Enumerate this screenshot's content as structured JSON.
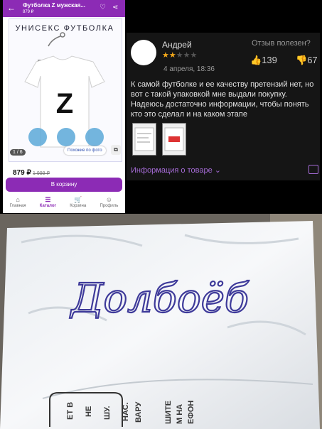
{
  "phone": {
    "header": {
      "back_icon": "arrow-left-icon",
      "title": "Футболка Z мужская...",
      "price": "879 ₽"
    },
    "banner": "УНИСЕКС ФУТБОЛКА",
    "shirt_letter": "Z",
    "image_counter": "1 / 6",
    "similar_button": "Похожие по фото",
    "price": "879 ₽",
    "old_price": "1 999 ₽",
    "cart_button": "В корзину",
    "nav": [
      {
        "label": "Главная",
        "icon": "home-icon",
        "glyph": "⌂"
      },
      {
        "label": "Каталог",
        "icon": "catalog-icon",
        "glyph": "☰"
      },
      {
        "label": "Корзина",
        "icon": "cart-icon",
        "glyph": "🛒"
      },
      {
        "label": "Профиль",
        "icon": "profile-icon",
        "glyph": "☺"
      }
    ],
    "accent": "#8c2bb5"
  },
  "review": {
    "name": "Андрей",
    "rating": 2,
    "rating_max": 5,
    "date": "4 апреля, 18:36",
    "useful_label": "Отзыв полезен?",
    "likes": "139",
    "dislikes": "67",
    "text": "К самой футболке и ее качеству претензий нет, но вот с такой упаковкой мне выдали покупку. Надеюсь достаточно информации, чтобы понять кто это сделал и на каком этапе",
    "product_info": "Информация о товаре",
    "star_color": "#f1a71a",
    "link_color": "#a56bd6"
  },
  "photo": {
    "handwriting": "Долбоёб",
    "package_text": [
      "ЕТ В",
      "НЕ",
      "ШУ.",
      "НАС.",
      "ВАРУ",
      "ШИТЕ",
      "М НА",
      "ЕФОН"
    ]
  }
}
